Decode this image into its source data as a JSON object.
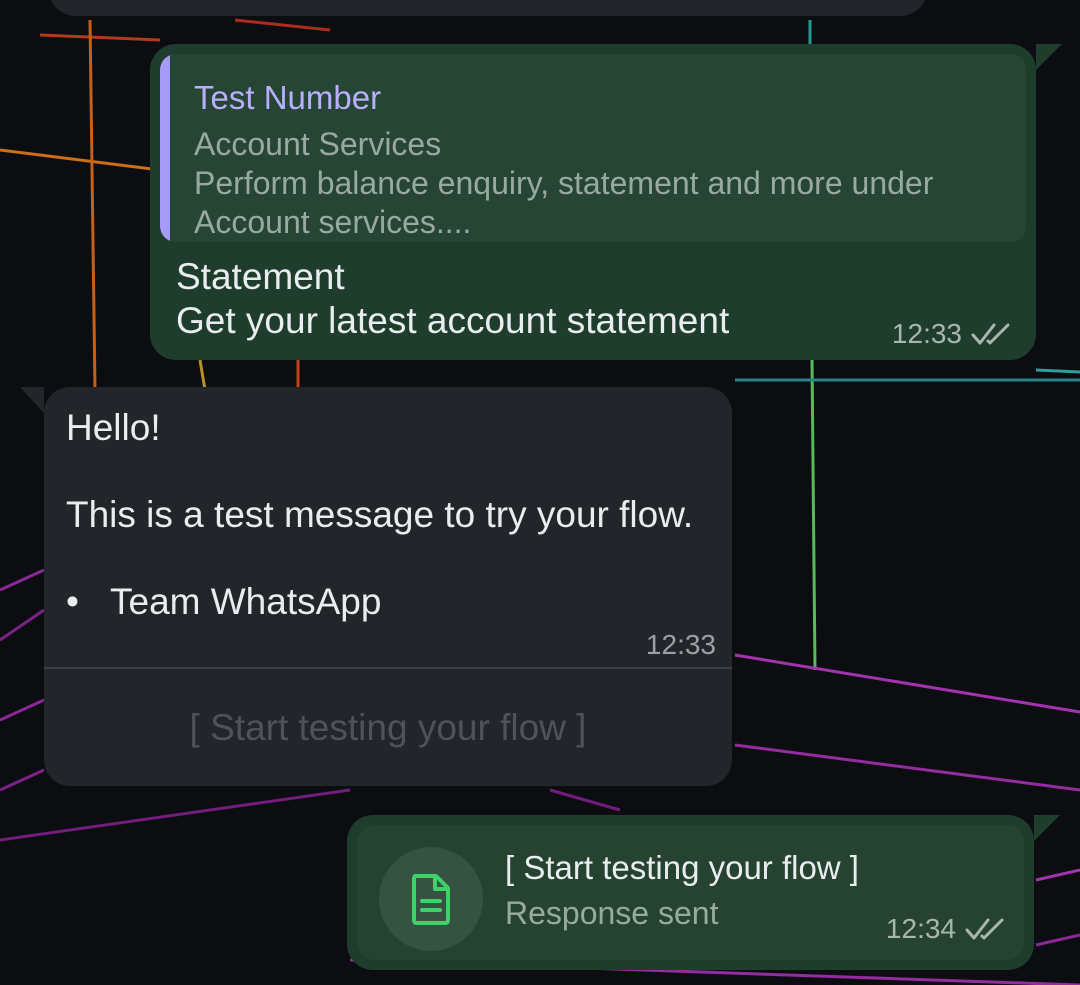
{
  "messages": {
    "quoted_reply": {
      "quote_title": "Test Number",
      "quote_lines": [
        "Account Services",
        "Perform balance enquiry, statement and more under",
        "Account services...."
      ],
      "body_lines": [
        "Statement",
        "Get your latest account statement"
      ],
      "time": "12:33",
      "status": "read"
    },
    "incoming": {
      "greeting": "Hello!",
      "text": "This is a test message to try your flow.",
      "bullet": "Team WhatsApp",
      "time": "12:33",
      "action_button": "[ Start testing your flow ]"
    },
    "flow_response": {
      "title": "[ Start testing your flow ]",
      "subtitle": "Response sent",
      "time": "12:34",
      "status": "read",
      "icon": "document-icon"
    }
  },
  "colors": {
    "outgoing_bubble": "#1f3d2c",
    "incoming_bubble": "#22262a",
    "quote_accent": "#a79cf5",
    "doc_icon": "#3fd16a"
  }
}
